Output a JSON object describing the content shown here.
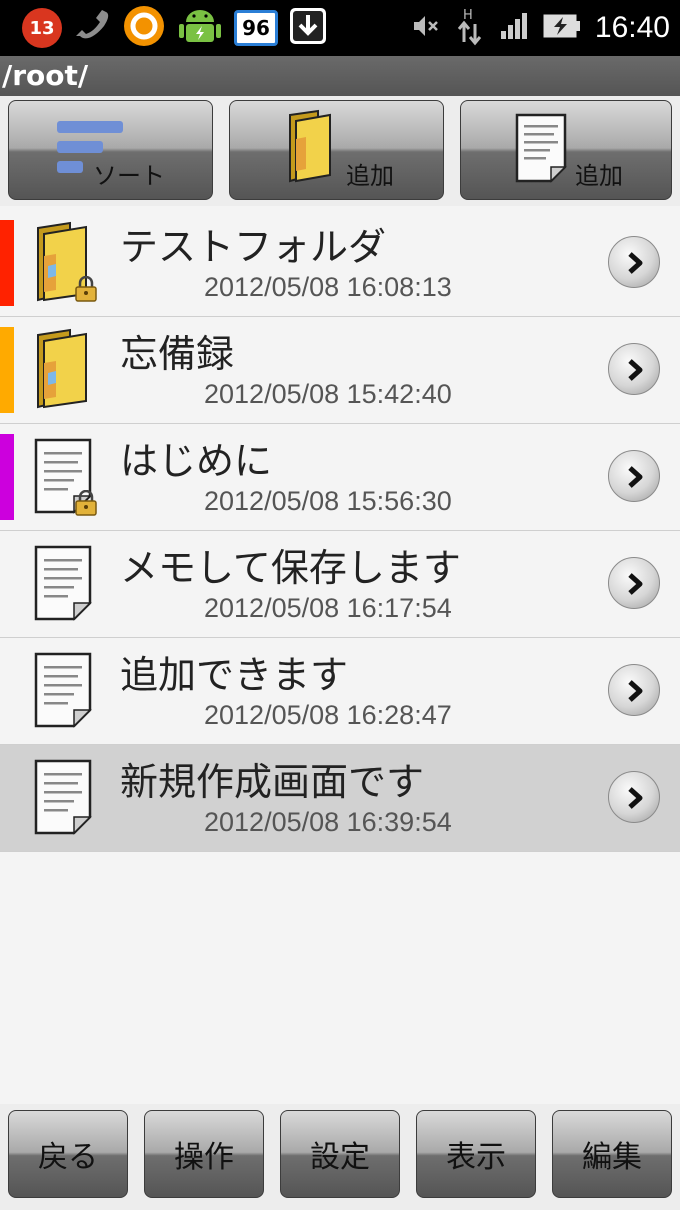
{
  "status_bar": {
    "notification_count": "13",
    "battery_level": "96",
    "time": "16:40",
    "network_label": "H",
    "icons": [
      "notification-badge",
      "phone-icon",
      "app-ring-icon",
      "android-icon",
      "battery-percent-icon",
      "download-icon",
      "mute-icon",
      "data-arrows-icon",
      "signal-icon",
      "battery-icon"
    ]
  },
  "path": "/root/",
  "toolbar": {
    "sort_label": "ソート",
    "add_folder_label": "追加",
    "add_file_label": "追加"
  },
  "items": [
    {
      "title": "テストフォルダ",
      "date": "2012/05/08 16:08:13",
      "type": "folder",
      "locked": true,
      "color": "#ff2200",
      "selected": false
    },
    {
      "title": "忘備録",
      "date": "2012/05/08 15:42:40",
      "type": "folder",
      "locked": false,
      "color": "#ffaa00",
      "selected": false
    },
    {
      "title": "はじめに",
      "date": "2012/05/08 15:56:30",
      "type": "file",
      "locked": true,
      "color": "#cc00dd",
      "selected": false
    },
    {
      "title": "メモして保存します",
      "date": "2012/05/08 16:17:54",
      "type": "file",
      "locked": false,
      "color": "",
      "selected": false
    },
    {
      "title": "追加できます",
      "date": "2012/05/08 16:28:47",
      "type": "file",
      "locked": false,
      "color": "",
      "selected": false
    },
    {
      "title": "新規作成画面です",
      "date": "2012/05/08 16:39:54",
      "type": "file",
      "locked": false,
      "color": "",
      "selected": true
    }
  ],
  "bottom_bar": {
    "back_label": "戻る",
    "operation_label": "操作",
    "settings_label": "設定",
    "display_label": "表示",
    "edit_label": "編集"
  }
}
